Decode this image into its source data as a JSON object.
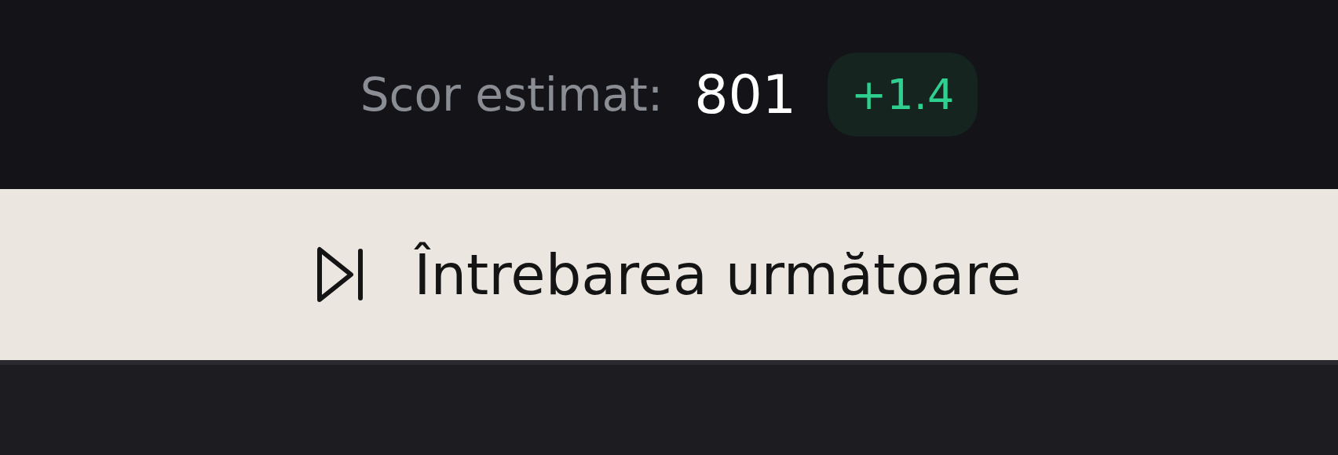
{
  "score": {
    "label": "Scor estimat:",
    "value": "801",
    "delta": "+1.4"
  },
  "next_button": {
    "label": "Întrebarea următoare"
  }
}
